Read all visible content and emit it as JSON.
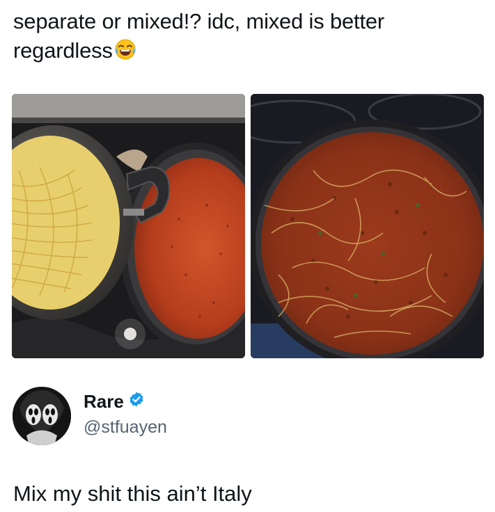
{
  "post": {
    "text": "separate or mixed!? idc, mixed is better regardless",
    "emoji": "face-with-tears-of-joy"
  },
  "media": {
    "left_description": "separate-pasta-and-sauce",
    "right_description": "mixed-spaghetti-bolognese"
  },
  "author": {
    "name": "Rare",
    "handle": "@stfuayen",
    "verified": true,
    "badge_color": "#1d9bf0"
  },
  "reply": {
    "text": "Mix my shit this ain’t Italy"
  }
}
